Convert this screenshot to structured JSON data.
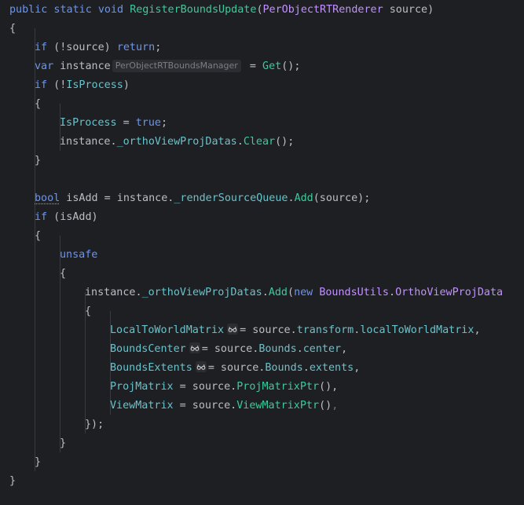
{
  "code": {
    "l1": {
      "kw": "public static void ",
      "method": "RegisterBoundsUpdate",
      "open": "(",
      "type": "PerObjectRTRenderer",
      "rest": " source)"
    },
    "l2": "{",
    "l3": {
      "kw1": "if",
      "mid": " (!source) ",
      "kw2": "return",
      "end": ";"
    },
    "l4": {
      "kw": "var",
      "name": " instance",
      "hint": "PerObjectRTBoundsManager",
      "eq": " = ",
      "method": "Get",
      "end": "();"
    },
    "l5": {
      "kw": "if",
      "mid": " (!",
      "field": "IsProcess",
      "end": ")"
    },
    "l6": "{",
    "l7": {
      "field": "IsProcess",
      "eq": " = ",
      "kw": "true",
      "end": ";"
    },
    "l8": {
      "pre": "instance.",
      "field": "_orthoViewProjDatas",
      "dot": ".",
      "method": "Clear",
      "end": "();"
    },
    "l9": "}",
    "l11": {
      "kw": "bool",
      "mid": " isAdd = instance.",
      "field": "_renderSourceQueue",
      "dot": ".",
      "method": "Add",
      "end": "(source);"
    },
    "l12": {
      "kw": "if",
      "rest": " (isAdd)"
    },
    "l13": "{",
    "l14": "unsafe",
    "l15": "{",
    "l16": {
      "pre": "instance.",
      "field": "_orthoViewProjDatas",
      "dot": ".",
      "method": "Add",
      "open": "(",
      "kw": "new",
      "sp": " ",
      "type1": "BoundsUtils",
      "dot2": ".",
      "type2": "OrthoViewProjData"
    },
    "l17": "{",
    "l18": {
      "prop": "LocalToWorldMatrix",
      "eq": "= source.",
      "p2": "transform",
      "dot": ".",
      "p3": "localToWorldMatrix",
      "end": ","
    },
    "l19": {
      "prop": "BoundsCenter",
      "eq": "= source.",
      "p2": "Bounds",
      "dot": ".",
      "p3": "center",
      "end": ","
    },
    "l20": {
      "prop": "BoundsExtents",
      "eq": "= source.",
      "p2": "Bounds",
      "dot": ".",
      "p3": "extents",
      "end": ","
    },
    "l21": {
      "prop": "ProjMatrix",
      "eq": " = source.",
      "method": "ProjMatrixPtr",
      "end": "(),"
    },
    "l22": {
      "prop": "ViewMatrix",
      "eq": " = source.",
      "method": "ViewMatrixPtr",
      "end": "()",
      "trail": ","
    },
    "l23": "});",
    "l24": "}",
    "l25": "}",
    "l26": "}"
  },
  "icons": {
    "write_access": "glasses-icon"
  },
  "colors": {
    "background": "#1e1f22",
    "keyword": "#6c95eb",
    "method": "#39cc9b",
    "type": "#c191ff",
    "field": "#66c3cc",
    "text": "#bcbec4"
  }
}
